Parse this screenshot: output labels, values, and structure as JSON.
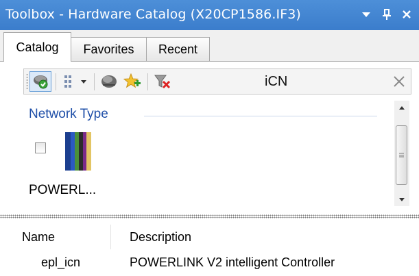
{
  "window": {
    "title": "Toolbox - Hardware Catalog (X20CP1586.IF3)",
    "controls": [
      "dropdown-icon",
      "pin-icon",
      "close-icon"
    ]
  },
  "tabs": [
    {
      "label": "Catalog",
      "active": true
    },
    {
      "label": "Favorites",
      "active": false
    },
    {
      "label": "Recent",
      "active": false
    }
  ],
  "toolbar": {
    "buttons": [
      "connect-icon",
      "view-mode-icon",
      "dropdown-arrow-icon",
      "hardware-icon",
      "add-favorite-icon",
      "clear-filter-icon"
    ],
    "search": {
      "value": "iCN",
      "placeholder": ""
    },
    "clear_icon": "close-icon"
  },
  "filter_group": {
    "header": "Network Type",
    "items": [
      {
        "label": "POWERL...",
        "checked": false,
        "icon": "powerlink-network-icon"
      }
    ]
  },
  "table": {
    "columns": [
      "Name",
      "Description"
    ],
    "rows": [
      {
        "name": "epl_icn",
        "description": "POWERLINK V2 intelligent Controller"
      }
    ]
  },
  "colors": {
    "titlebar": "#3f81cf",
    "group_header": "#1f4fa8",
    "accent": "#3b7dcc"
  }
}
